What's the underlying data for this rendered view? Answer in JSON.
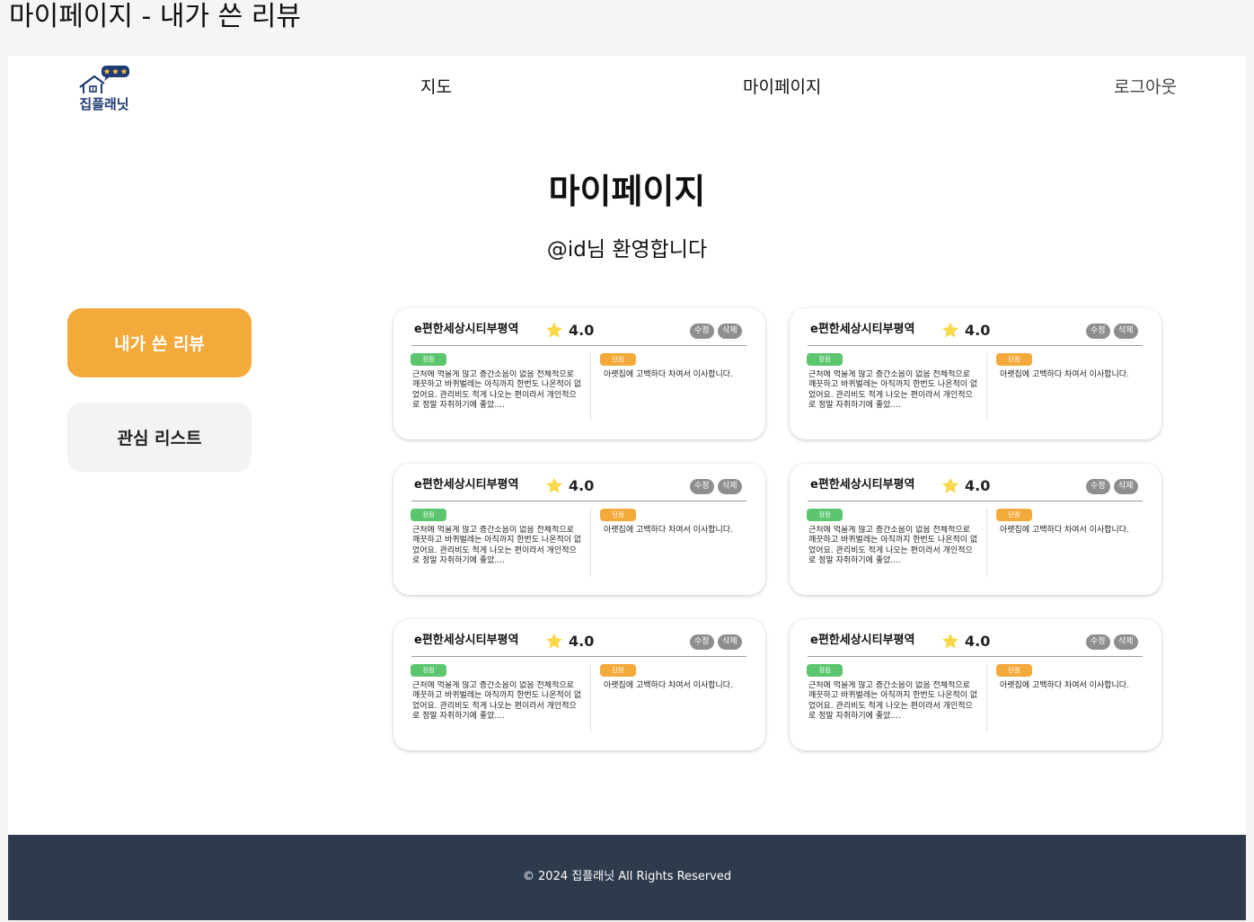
{
  "window_title": "마이페이지 - 내가 쓴 리뷰",
  "header": {
    "logo_text": "집플래닛",
    "nav": {
      "map": "지도",
      "mypage": "마이페이지",
      "logout": "로그아웃"
    }
  },
  "main": {
    "heading": "마이페이지",
    "welcome": "@id님 환영합니다"
  },
  "sidebar": {
    "items": [
      {
        "label": "내가 쓴 리뷰",
        "active": true
      },
      {
        "label": "관심 리스트",
        "active": false
      }
    ]
  },
  "reviews": [
    {
      "title": "e편한세상시티부평역",
      "rating": "4.0",
      "edit_label": "수정",
      "delete_label": "삭제",
      "pro_tag": "장점",
      "con_tag": "단점",
      "pro_text": "근처에 먹을게 많고 층간소음이 없음 전체적으로 깨끗하고 바퀴벌레는 아직까지 한번도 나온적이 없었어요. 관리비도 적게 나오는 편이라서 개인적으로 정말 자취하기에 좋았....",
      "con_text": "아랫집에 고백하다 차여서 이사합니다."
    },
    {
      "title": "e편한세상시티부평역",
      "rating": "4.0",
      "edit_label": "수정",
      "delete_label": "삭제",
      "pro_tag": "장점",
      "con_tag": "단점",
      "pro_text": "근처에 먹을게 많고 층간소음이 없음 전체적으로 깨끗하고 바퀴벌레는 아직까지 한번도 나온적이 없었어요. 관리비도 적게 나오는 편이라서 개인적으로 정말 자취하기에 좋았....",
      "con_text": "아랫집에 고백하다 차여서 이사합니다."
    },
    {
      "title": "e편한세상시티부평역",
      "rating": "4.0",
      "edit_label": "수정",
      "delete_label": "삭제",
      "pro_tag": "장점",
      "con_tag": "단점",
      "pro_text": "근처에 먹을게 많고 층간소음이 없음 전체적으로 깨끗하고 바퀴벌레는 아직까지 한번도 나온적이 없었어요. 관리비도 적게 나오는 편이라서 개인적으로 정말 자취하기에 좋았....",
      "con_text": "아랫집에 고백하다 차여서 이사합니다."
    },
    {
      "title": "e편한세상시티부평역",
      "rating": "4.0",
      "edit_label": "수정",
      "delete_label": "삭제",
      "pro_tag": "장점",
      "con_tag": "단점",
      "pro_text": "근처에 먹을게 많고 층간소음이 없음 전체적으로 깨끗하고 바퀴벌레는 아직까지 한번도 나온적이 없었어요. 관리비도 적게 나오는 편이라서 개인적으로 정말 자취하기에 좋았....",
      "con_text": "아랫집에 고백하다 차여서 이사합니다."
    },
    {
      "title": "e편한세상시티부평역",
      "rating": "4.0",
      "edit_label": "수정",
      "delete_label": "삭제",
      "pro_tag": "장점",
      "con_tag": "단점",
      "pro_text": "근처에 먹을게 많고 층간소음이 없음 전체적으로 깨끗하고 바퀴벌레는 아직까지 한번도 나온적이 없었어요. 관리비도 적게 나오는 편이라서 개인적으로 정말 자취하기에 좋았....",
      "con_text": "아랫집에 고백하다 차여서 이사합니다."
    },
    {
      "title": "e편한세상시티부평역",
      "rating": "4.0",
      "edit_label": "수정",
      "delete_label": "삭제",
      "pro_tag": "장점",
      "con_tag": "단점",
      "pro_text": "근처에 먹을게 많고 층간소음이 없음 전체적으로 깨끗하고 바퀴벌레는 아직까지 한번도 나온적이 없었어요. 관리비도 적게 나오는 편이라서 개인적으로 정말 자취하기에 좋았....",
      "con_text": "아랫집에 고백하다 차여서 이사합니다."
    }
  ],
  "footer": {
    "copyright": "© 2024 집플래닛 All Rights Reserved"
  },
  "colors": {
    "accent": "#f4aa3b",
    "pro": "#5cc66f",
    "footer_bg": "#2e3b4d",
    "star": "#f9d84a",
    "logo_navy": "#1f3b73"
  },
  "icons": {
    "rating": "star-icon",
    "logo": "house-chat-logo-icon"
  }
}
